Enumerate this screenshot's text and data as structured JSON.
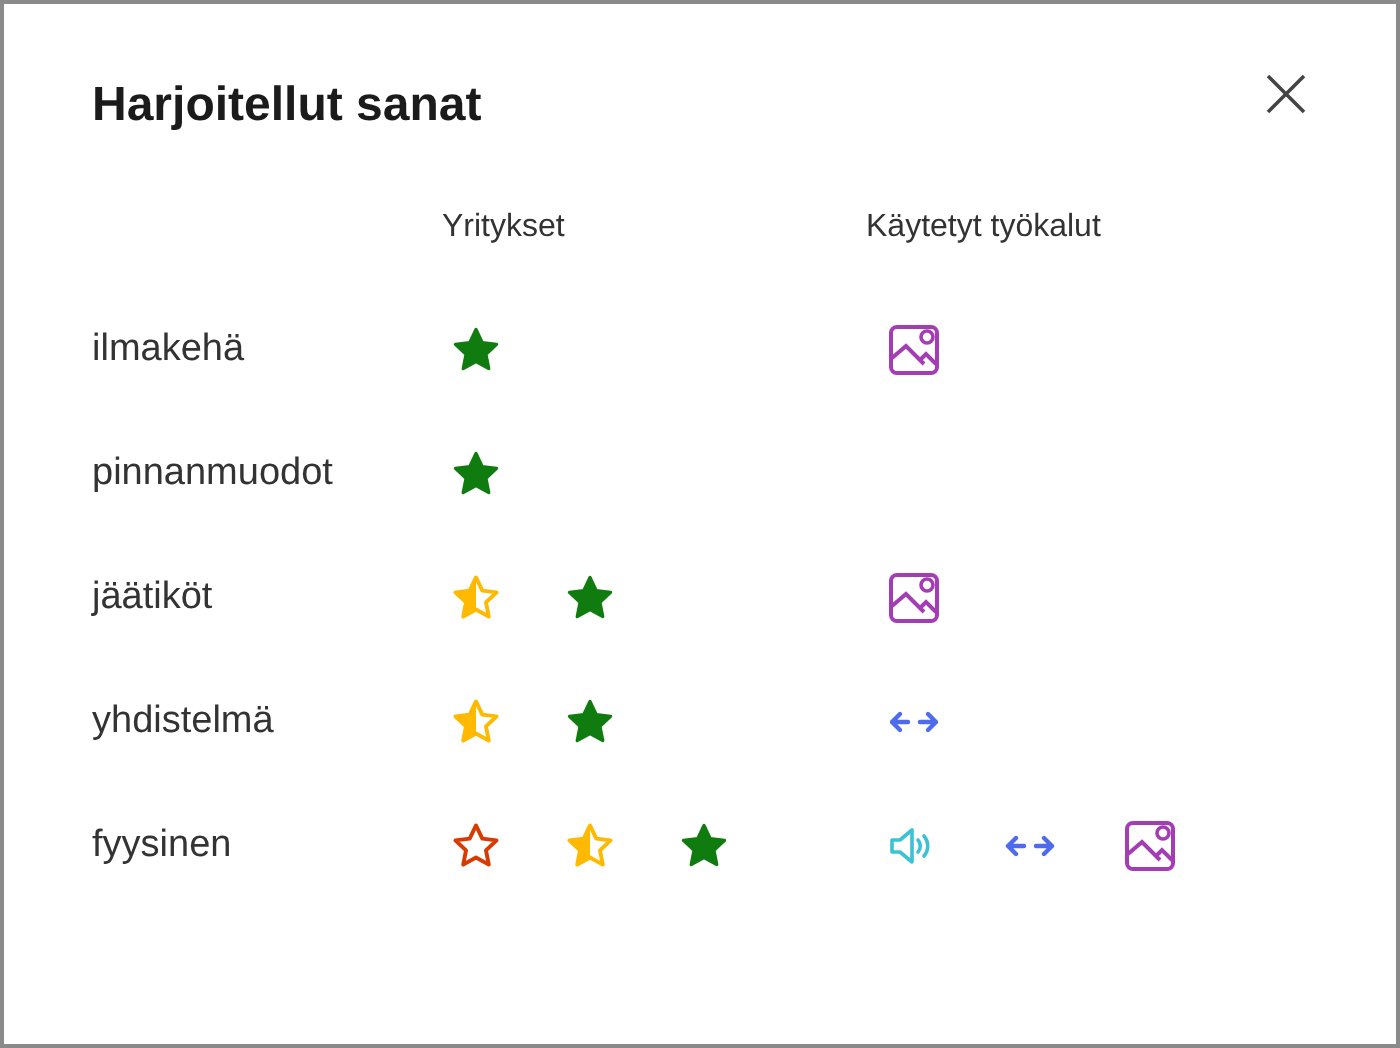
{
  "title": "Harjoitellut sanat",
  "columns": [
    "Yritykset",
    "Käytetyt työkalut"
  ],
  "words": [
    {
      "word": "ilmakehä",
      "attempts": [
        {
          "kind": "full"
        }
      ],
      "tools": [
        {
          "kind": "picture"
        }
      ]
    },
    {
      "word": "pinnanmuodot",
      "attempts": [
        {
          "kind": "full"
        }
      ]
    },
    {
      "word": "jäätiköt",
      "attempts": [
        {
          "kind": "half"
        },
        {
          "kind": "full"
        }
      ],
      "tools": [
        {
          "kind": "picture"
        }
      ]
    },
    {
      "word": "yhdistelmä",
      "attempts": [
        {
          "kind": "half"
        },
        {
          "kind": "full"
        }
      ],
      "tools": [
        {
          "kind": "translate"
        }
      ]
    },
    {
      "word": "fyysinen",
      "attempts": [
        {
          "kind": "empty"
        },
        {
          "kind": "half"
        },
        {
          "kind": "full"
        }
      ],
      "tools": [
        {
          "kind": "audio"
        },
        {
          "kind": "translate"
        },
        {
          "kind": "picture"
        }
      ]
    }
  ]
}
